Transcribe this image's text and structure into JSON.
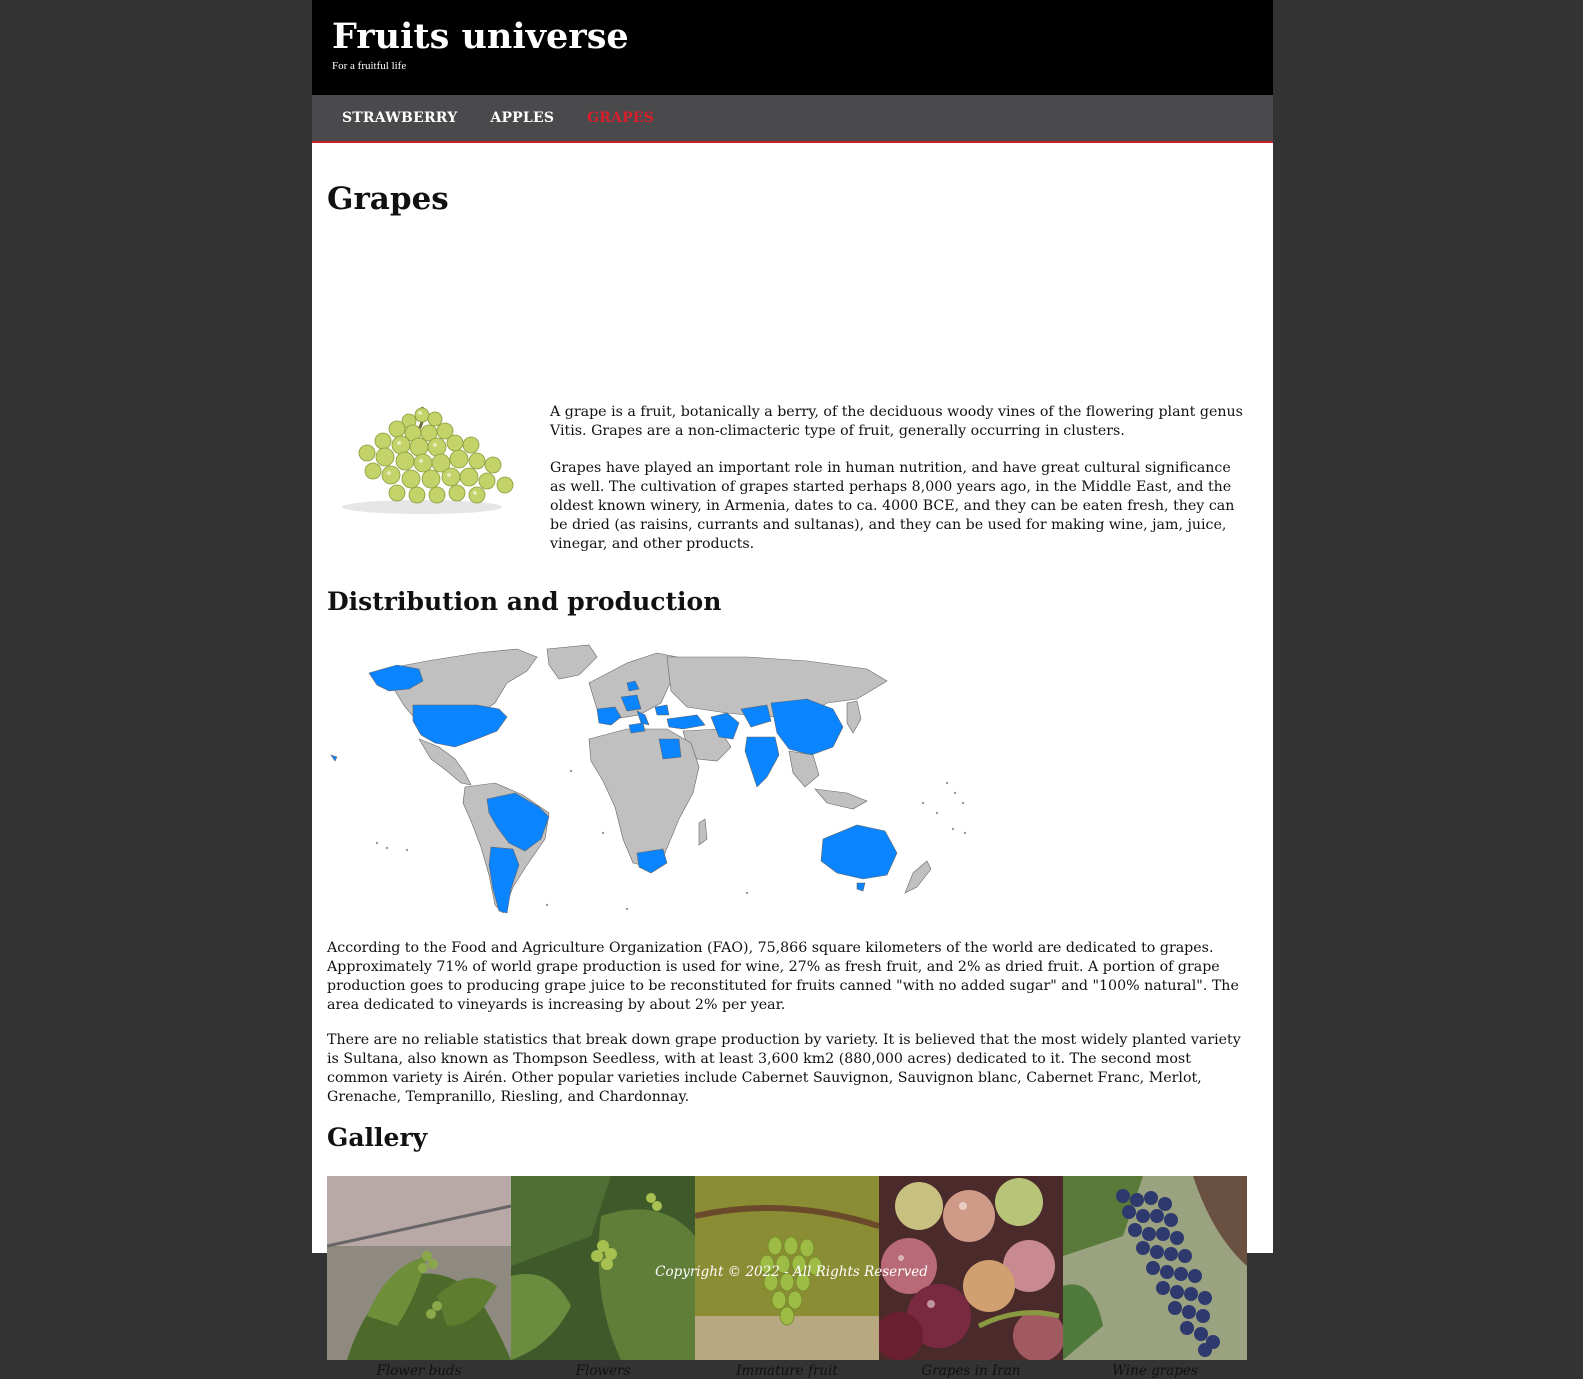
{
  "header": {
    "title": "Fruits universe",
    "tagline": "For a fruitful life"
  },
  "nav": {
    "items": [
      {
        "label": "STRAWBERRY",
        "active": false
      },
      {
        "label": "APPLES",
        "active": false
      },
      {
        "label": "GRAPES",
        "active": true
      }
    ]
  },
  "main": {
    "heading": "Grapes",
    "intro": [
      "A grape is a fruit, botanically a berry, of the deciduous woody vines of the flowering plant genus Vitis. Grapes are a non-climacteric type of fruit, generally occurring in clusters.",
      "Grapes have played an important role in human nutrition, and have great cultural significance as well. The cultivation of grapes started perhaps 8,000 years ago, in the Middle East, and the oldest known winery, in Armenia, dates to ca. 4000 BCE, and they can be eaten fresh, they can be dried (as raisins, currants and sultanas), and they can be used for making wine, jam, juice, vinegar, and other products."
    ],
    "distribution_heading": "Distribution and production",
    "distribution_paragraphs": [
      "According to the Food and Agriculture Organization (FAO), 75,866 square kilometers of the world are dedicated to grapes. Approximately 71% of world grape production is used for wine, 27% as fresh fruit, and 2% as dried fruit. A portion of grape production goes to producing grape juice to be reconstituted for fruits canned \"with no added sugar\" and \"100% natural\". The area dedicated to vineyards is increasing by about 2% per year.",
      "There are no reliable statistics that break down grape production by variety. It is believed that the most widely planted variety is Sultana, also known as Thompson Seedless, with at least 3,600 km2 (880,000 acres) dedicated to it. The second most common variety is Airén. Other popular varieties include Cabernet Sauvignon, Sauvignon blanc, Cabernet Franc, Merlot, Grenache, Tempranillo, Riesling, and Chardonnay."
    ],
    "gallery_heading": "Gallery",
    "gallery": [
      {
        "caption": "Flower buds"
      },
      {
        "caption": "Flowers"
      },
      {
        "caption": "Immature fruit"
      },
      {
        "caption": "Grapes in Iran"
      },
      {
        "caption": "Wine grapes"
      }
    ]
  },
  "footer": {
    "text": "Copyright © 2022 - All Rights Reserved"
  },
  "colors": {
    "page_bg": "#333333",
    "header_bg": "#000000",
    "nav_bg": "#4a4a4c",
    "nav_active": "#d91e2a",
    "map_highlight": "#0a84ff",
    "map_land": "#c0c0c0"
  }
}
